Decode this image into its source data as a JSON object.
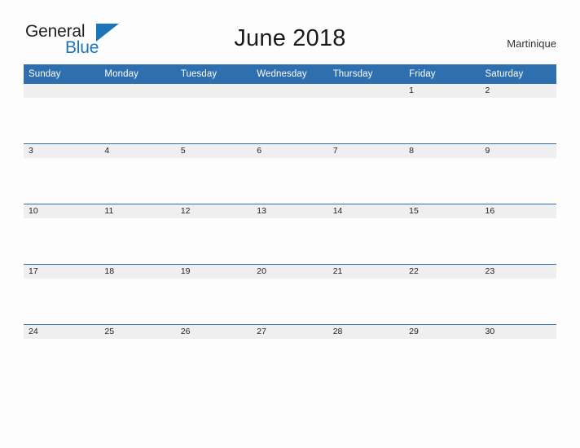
{
  "brand": {
    "name_part1": "General",
    "name_part2": "Blue",
    "flag_icon": "flag-triangle-icon"
  },
  "header": {
    "title": "June 2018",
    "location": "Martinique"
  },
  "calendar": {
    "month": "June",
    "year": "2018",
    "weekday_headers": [
      "Sunday",
      "Monday",
      "Tuesday",
      "Wednesday",
      "Thursday",
      "Friday",
      "Saturday"
    ],
    "colors": {
      "header_blue": "#2e6faf",
      "band_gray": "#efefef",
      "brand_blue": "#1b75bb",
      "text_dark": "#231f20",
      "page_background": "#fdfdfd"
    },
    "weeks": [
      [
        "",
        "",
        "",
        "",
        "",
        "1",
        "2"
      ],
      [
        "3",
        "4",
        "5",
        "6",
        "7",
        "8",
        "9"
      ],
      [
        "10",
        "11",
        "12",
        "13",
        "14",
        "15",
        "16"
      ],
      [
        "17",
        "18",
        "19",
        "20",
        "21",
        "22",
        "23"
      ],
      [
        "24",
        "25",
        "26",
        "27",
        "28",
        "29",
        "30"
      ]
    ]
  }
}
